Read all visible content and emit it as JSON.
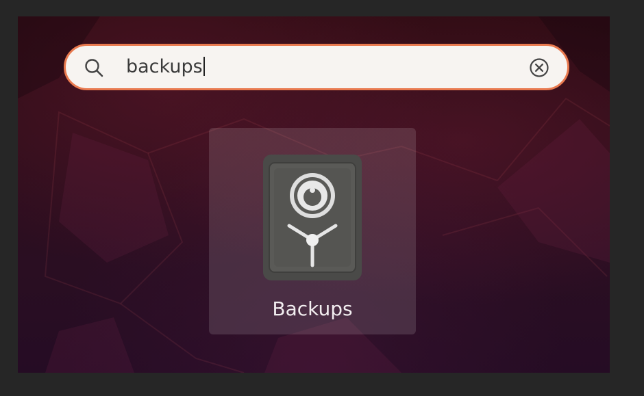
{
  "search": {
    "query": "backups"
  },
  "results": [
    {
      "label": "Backups",
      "icon": "backups-safe-icon"
    }
  ],
  "colors": {
    "search_border": "#e97a4f",
    "search_background": "#f7f4f1",
    "tile_highlight": "rgba(255,255,255,0.13)"
  }
}
